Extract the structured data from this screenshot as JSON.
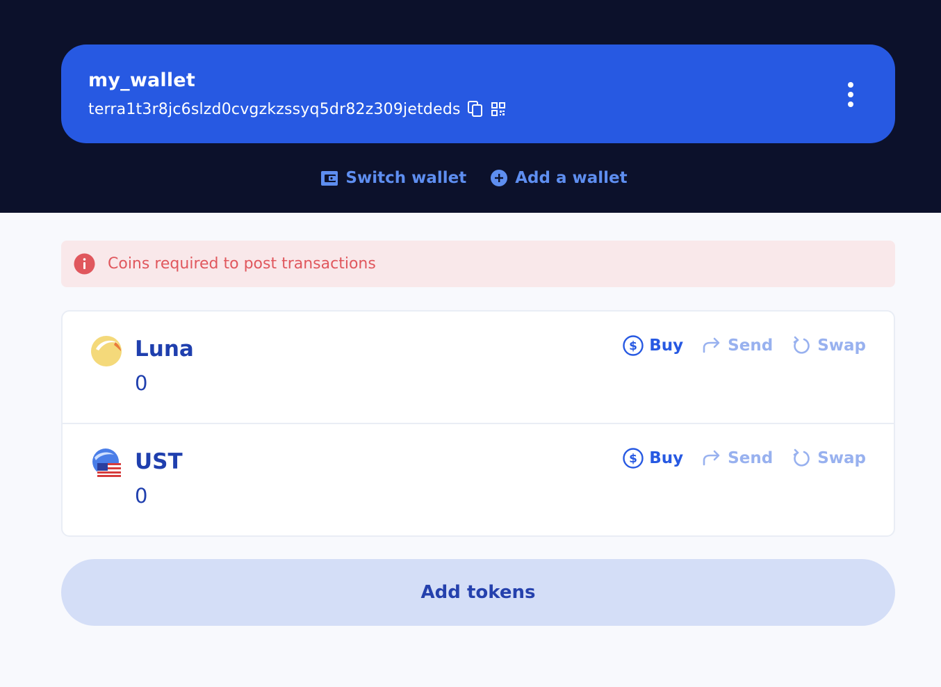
{
  "wallet": {
    "name": "my_wallet",
    "address": "terra1t3r8jc6slzd0cvgzkzssyq5dr82z309jetdeds",
    "copy_icon": "copy-icon",
    "qr_icon": "qr-code-icon",
    "more_icon": "more-vertical-icon"
  },
  "wallet_actions": {
    "switch_label": "Switch wallet",
    "add_label": "Add a wallet"
  },
  "alert": {
    "message": "Coins required to post transactions",
    "icon": "info-icon"
  },
  "assets": [
    {
      "name": "Luna",
      "amount": "0",
      "actions": {
        "buy": "Buy",
        "send": "Send",
        "swap": "Swap"
      }
    },
    {
      "name": "UST",
      "amount": "0",
      "actions": {
        "buy": "Buy",
        "send": "Send",
        "swap": "Swap"
      }
    }
  ],
  "add_tokens_label": "Add tokens",
  "colors": {
    "header_bg": "#0c112b",
    "card_bg": "#2759e2",
    "accent": "#5e8ef0",
    "alert_text": "#e0575d",
    "alert_bg": "#f9e8ea",
    "token_text": "#1f3fae",
    "muted_action": "#98b1ef",
    "add_tokens_bg": "#d4def7"
  }
}
